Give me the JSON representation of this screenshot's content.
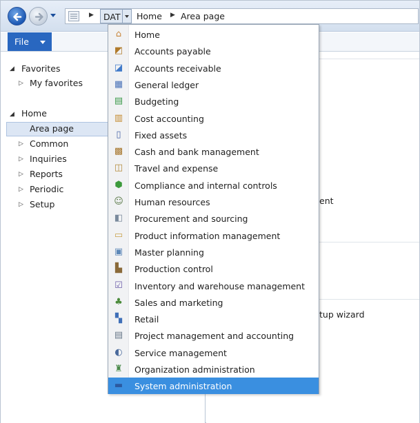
{
  "address_bar": {
    "crumbs": [
      {
        "label": "DAT"
      },
      {
        "label": "Home"
      },
      {
        "label": "Area page"
      }
    ]
  },
  "ribbon": {
    "file_label": "File"
  },
  "nav_pane": {
    "favorites": {
      "label": "Favorites",
      "children": [
        {
          "label": "My favorites"
        }
      ]
    },
    "home": {
      "label": "Home",
      "children": [
        {
          "label": "Area page"
        },
        {
          "label": "Common"
        },
        {
          "label": "Inquiries"
        },
        {
          "label": "Reports"
        },
        {
          "label": "Periodic"
        },
        {
          "label": "Setup"
        }
      ]
    }
  },
  "content": {
    "partial_1": "ent",
    "partial_2": "tup wizard"
  },
  "menu": {
    "items": [
      {
        "label": "Home",
        "icon": "house-icon",
        "color": "#c9863b",
        "glyph": "⌂"
      },
      {
        "label": "Accounts payable",
        "icon": "payable-icon",
        "color": "#b07a2a",
        "glyph": "◩"
      },
      {
        "label": "Accounts receivable",
        "icon": "receivable-icon",
        "color": "#3f79c9",
        "glyph": "◪"
      },
      {
        "label": "General ledger",
        "icon": "ledger-icon",
        "color": "#4a72b8",
        "glyph": "▦"
      },
      {
        "label": "Budgeting",
        "icon": "budget-icon",
        "color": "#3c9a4a",
        "glyph": "▤"
      },
      {
        "label": "Cost accounting",
        "icon": "cost-icon",
        "color": "#c48a2e",
        "glyph": "▥"
      },
      {
        "label": "Fixed assets",
        "icon": "fixed-assets-icon",
        "color": "#4a66a8",
        "glyph": "▯"
      },
      {
        "label": "Cash and bank management",
        "icon": "cash-bank-icon",
        "color": "#a7762c",
        "glyph": "▩"
      },
      {
        "label": "Travel and expense",
        "icon": "travel-expense-icon",
        "color": "#b48b3b",
        "glyph": "◫"
      },
      {
        "label": "Compliance and internal controls",
        "icon": "compliance-icon",
        "color": "#3c9a3c",
        "glyph": "⬢"
      },
      {
        "label": "Human resources",
        "icon": "human-resources-icon",
        "color": "#5c7a4a",
        "glyph": "☺"
      },
      {
        "label": "Procurement and sourcing",
        "icon": "procurement-icon",
        "color": "#7a8a9c",
        "glyph": "◧"
      },
      {
        "label": "Product information management",
        "icon": "product-info-icon",
        "color": "#c8a24a",
        "glyph": "▭"
      },
      {
        "label": "Master planning",
        "icon": "master-planning-icon",
        "color": "#5d88b8",
        "glyph": "▣"
      },
      {
        "label": "Production control",
        "icon": "production-icon",
        "color": "#8a6a3a",
        "glyph": "▙"
      },
      {
        "label": "Inventory and warehouse management",
        "icon": "inventory-icon",
        "color": "#6a5aa8",
        "glyph": "☑"
      },
      {
        "label": "Sales and marketing",
        "icon": "sales-icon",
        "color": "#4a8a3a",
        "glyph": "♣"
      },
      {
        "label": "Retail",
        "icon": "retail-icon",
        "color": "#3f6fb8",
        "glyph": "▚"
      },
      {
        "label": "Project management and accounting",
        "icon": "project-icon",
        "color": "#6a7a8a",
        "glyph": "▤"
      },
      {
        "label": "Service management",
        "icon": "service-icon",
        "color": "#4a6a9c",
        "glyph": "◐"
      },
      {
        "label": "Organization administration",
        "icon": "org-admin-icon",
        "color": "#4a8a4a",
        "glyph": "♜"
      },
      {
        "label": "System administration",
        "icon": "system-admin-icon",
        "color": "#2c5aa0",
        "glyph": "▬",
        "selected": true
      }
    ]
  }
}
